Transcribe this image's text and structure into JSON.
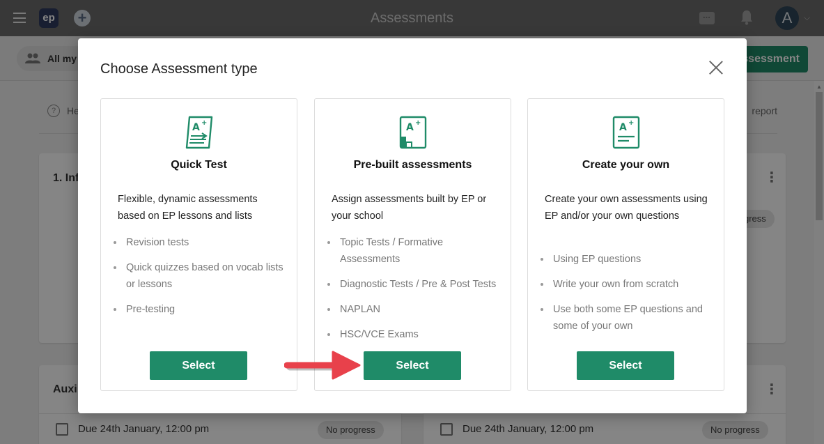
{
  "app": {
    "title": "Assessments",
    "logo_text": "ep",
    "avatar_letter": "A"
  },
  "background": {
    "filter_label": "All my",
    "new_assessment_label": "ssessment",
    "help_label": "He",
    "report_label": "report",
    "cards": [
      {
        "title": "1. Inf",
        "progress": "gress"
      },
      {
        "title": "Auxi",
        "due": "Due 24th January, 12:00 pm",
        "progress": "No progress"
      },
      {
        "title": "",
        "due": "Due 24th January, 12:00 pm",
        "progress": "No progress"
      }
    ]
  },
  "modal": {
    "title": "Choose Assessment type",
    "cards": [
      {
        "icon": "quick-test-icon",
        "title": "Quick Test",
        "description": "Flexible, dynamic assessments based on EP lessons and lists",
        "items": [
          "Revision tests",
          "Quick quizzes based on vocab lists or lessons",
          "Pre-testing"
        ],
        "button": "Select"
      },
      {
        "icon": "prebuilt-assessment-icon",
        "title": "Pre-built assessments",
        "description": "Assign assessments built by EP or your school",
        "items": [
          "Topic Tests / Formative Assessments",
          "Diagnostic Tests / Pre & Post Tests",
          "NAPLAN",
          "HSC/VCE Exams"
        ],
        "button": "Select"
      },
      {
        "icon": "create-own-icon",
        "title": "Create your own",
        "description": "Create your own assessments using EP and/or your own questions",
        "items": [
          "Using EP questions",
          "Write your own from scratch",
          "Use both some EP questions and some of your own"
        ],
        "button": "Select"
      }
    ]
  },
  "colors": {
    "primary_green": "#1f8b68",
    "arrow_red": "#e8414b",
    "topbar": "#6b6b6b"
  }
}
